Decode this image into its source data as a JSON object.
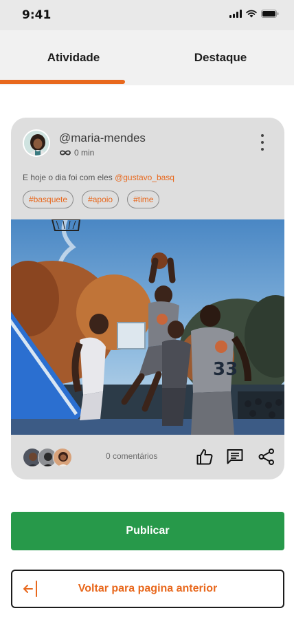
{
  "status_bar": {
    "time": "9:41"
  },
  "tabs": [
    {
      "label": "Atividade",
      "active": true
    },
    {
      "label": "Destaque",
      "active": false
    }
  ],
  "post": {
    "username": "@maria-mendes",
    "time": "0 min",
    "caption_text": "E hoje o dia foi com eles ",
    "mention": "@gustavo_basq",
    "hashtags": [
      "#basquete",
      "#apoio",
      "#time"
    ],
    "comments": "0 comentários",
    "actions": [
      "like-icon",
      "comment-icon",
      "share-icon"
    ]
  },
  "buttons": {
    "publish": "Publicar",
    "back": "Voltar para pagina anterior"
  },
  "colors": {
    "accent": "#e8681d",
    "publish": "#27994a",
    "card": "#dedede"
  }
}
